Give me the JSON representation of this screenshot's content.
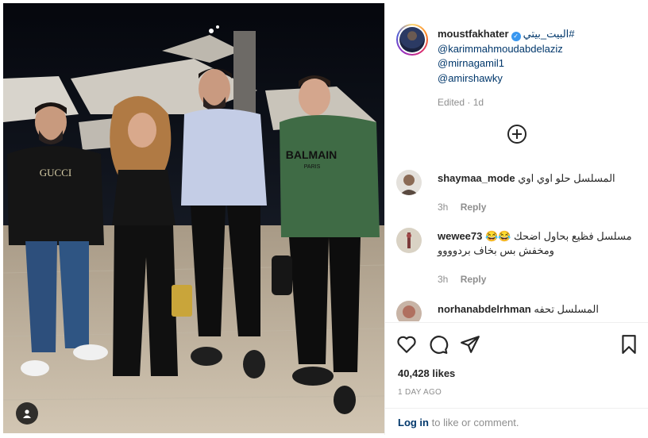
{
  "post": {
    "username": "moustfakhater",
    "hashtag": "البيت_بيتي#",
    "mentions": [
      "@karimmahmoudabdelaziz",
      "@mirnagamil1",
      "@amirshawky"
    ],
    "edited": "Edited · 1d"
  },
  "photo": {
    "shirt_text_1": "GUCCI",
    "shirt_text_2": "BALMAIN",
    "shirt_text_3": "PARIS"
  },
  "comments": [
    {
      "username": "shaymaa_mode",
      "text": "المسلسل حلو اوي اوي",
      "time": "3h",
      "reply": "Reply"
    },
    {
      "username": "wewee73",
      "text": "مسلسل فظيع بحاول اضحك 😂😂 ومخفش بس بخاف بردوووو",
      "time": "3h",
      "reply": "Reply"
    },
    {
      "username": "norhanabdelrhman",
      "text": "المسلسل تحفه"
    }
  ],
  "stats": {
    "likes": "40,428 likes",
    "date": "1 DAY AGO"
  },
  "login": {
    "link": "Log in",
    "rest": " to like or comment."
  },
  "icons": [
    "heart-icon",
    "comment-icon",
    "share-icon",
    "bookmark-icon",
    "plus-circle-icon",
    "person-tag-icon",
    "verified-badge-icon"
  ],
  "colors": {
    "link": "#00376b",
    "verified": "#3897f0",
    "muted": "#8e8e8e"
  }
}
